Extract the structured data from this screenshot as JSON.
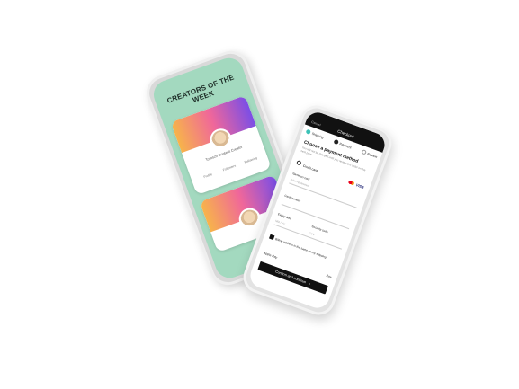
{
  "phone1": {
    "headline": "CREATORS OF THE WEEK",
    "card1": {
      "name": "Tomsch Content Creator",
      "stats": [
        "Profile",
        "Followers",
        "Following"
      ]
    }
  },
  "phone2": {
    "topbar": {
      "cancel": "Cancel",
      "title": "Checkout"
    },
    "steps": [
      {
        "label": "Shipping"
      },
      {
        "label": "Payment"
      },
      {
        "label": "Review"
      }
    ],
    "payment_title": "Choose a payment method",
    "payment_sub": "You will not be charged until you review this order on the next page",
    "method_label": "Credit card",
    "visa_label": "VISA",
    "fields": {
      "name_label": "Name on card",
      "name_placeholder": "John Appleseed",
      "number_label": "Card number",
      "date_label": "Expiry date",
      "security_label": "Security code",
      "date_placeholder": "MM / YY",
      "security_placeholder": "CVV"
    },
    "billing_label": "Billing address is the same as my shipping",
    "applepay_label": "Apple Pay",
    "applepay_logo": "Pay",
    "confirm_label": "Confirm and continue"
  },
  "colors": {
    "phone1_bg": "#a3d9bf",
    "accent": "#3cc2b7",
    "gradient": [
      "#f7b44a",
      "#f0679a",
      "#7b4ee6"
    ]
  }
}
